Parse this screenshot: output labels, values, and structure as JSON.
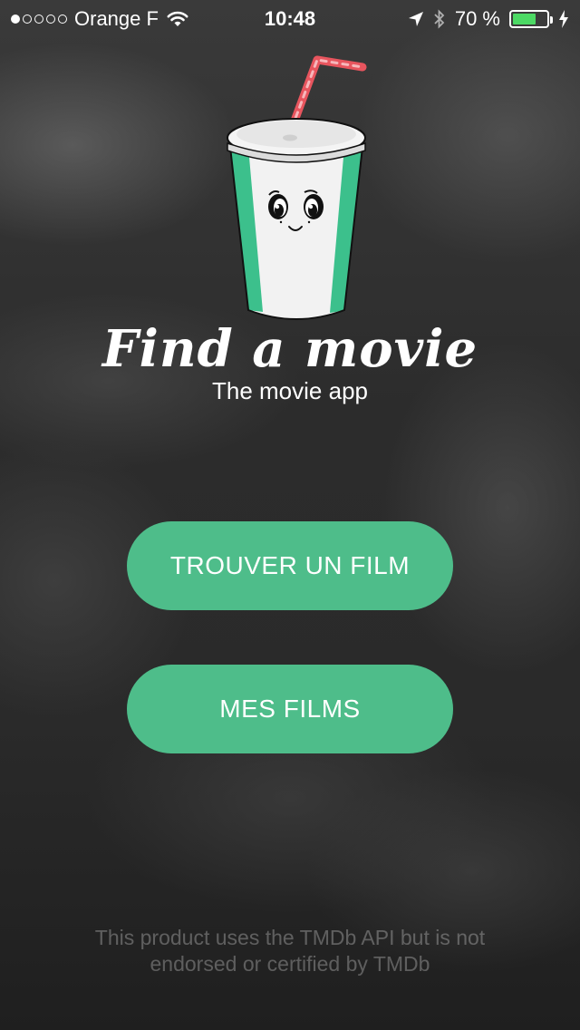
{
  "status_bar": {
    "carrier": "Orange F",
    "time": "10:48",
    "battery_text": "70 %",
    "battery_level": 0.7,
    "signal_bars_filled": 1,
    "signal_bars_total": 5,
    "battery_color": "#4cd964"
  },
  "logo": {
    "title": "Find a movie",
    "subtitle": "The movie app",
    "icon": "soda-cup-mascot-icon"
  },
  "buttons": {
    "find_label": "TROUVER UN FILM",
    "mine_label": "MES FILMS"
  },
  "footer": {
    "line1": "This product uses the TMDb API but is not",
    "line2": "endorsed or certified by TMDb"
  },
  "colors": {
    "accent": "#4ebd8a",
    "cup_stripe": "#3cc08c",
    "straw": "#e8555e"
  }
}
